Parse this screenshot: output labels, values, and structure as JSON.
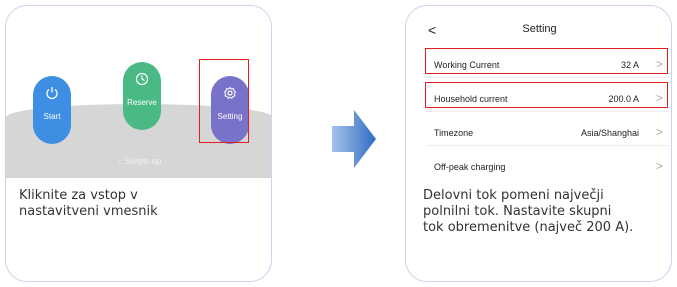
{
  "left_panel": {
    "buttons": {
      "start": "Start",
      "reserve": "Reserve",
      "setting": "Setting"
    },
    "swipe_hint": "↑ Swipe up",
    "caption": "Kliknite za vstop v\nnastavitveni vmesnik"
  },
  "right_panel": {
    "nav": {
      "back": "<",
      "title": "Setting"
    },
    "rows": [
      {
        "label": "Working Current",
        "value": "32 A",
        "chevron": ">"
      },
      {
        "label": "Household current",
        "value": "200.0 A",
        "chevron": ">"
      },
      {
        "label": "Timezone",
        "value": "Asia/Shanghai",
        "chevron": ">"
      },
      {
        "label": "Off-peak charging",
        "value": "",
        "chevron": ">"
      }
    ],
    "caption": "Delovni tok pomeni največji\npolnilni tok. Nastavite skupni\ntok obremenitve (največ 200 A)."
  },
  "colors": {
    "card_border": "#c9d3ea",
    "start": "#3e8fe3",
    "reserve": "#4aba84",
    "setting": "#7872c9",
    "highlight": "#e02020",
    "arrow": "#3d78c8"
  },
  "icons": [
    "power-icon",
    "clock-icon",
    "gear-icon",
    "back-arrow-icon",
    "chevron-right-icon",
    "arrow-right-icon"
  ]
}
